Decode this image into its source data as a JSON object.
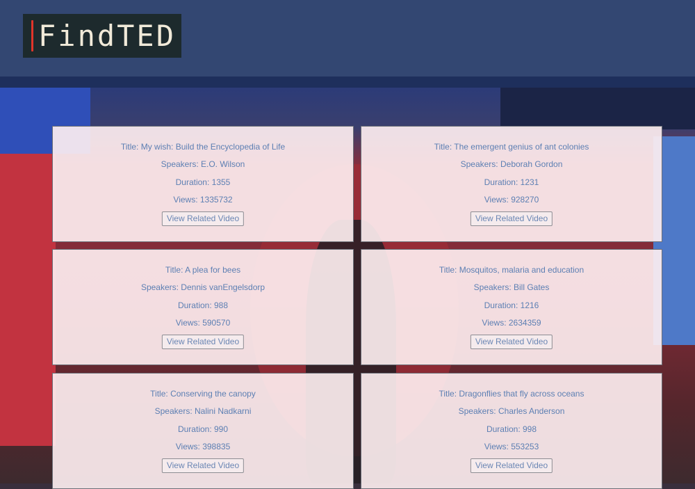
{
  "header": {
    "logo_text": "FindTED"
  },
  "cards": [
    {
      "title": "Title: My wish: Build the Encyclopedia of Life",
      "speakers": "Speakers: E.O. Wilson",
      "duration": "Duration: 1355",
      "views": "Views: 1335732",
      "button": "View Related Video"
    },
    {
      "title": "Title: The emergent genius of ant colonies",
      "speakers": "Speakers: Deborah Gordon",
      "duration": "Duration: 1231",
      "views": "Views: 928270",
      "button": "View Related Video"
    },
    {
      "title": "Title: A plea for bees",
      "speakers": "Speakers: Dennis vanEngelsdorp",
      "duration": "Duration: 988",
      "views": "Views: 590570",
      "button": "View Related Video"
    },
    {
      "title": "Title: Mosquitos, malaria and education",
      "speakers": "Speakers: Bill Gates",
      "duration": "Duration: 1216",
      "views": "Views: 2634359",
      "button": "View Related Video"
    },
    {
      "title": "Title: Conserving the canopy",
      "speakers": "Speakers: Nalini Nadkarni",
      "duration": "Duration: 990",
      "views": "Views: 398835",
      "button": "View Related Video"
    },
    {
      "title": "Title: Dragonflies that fly across oceans",
      "speakers": "Speakers: Charles Anderson",
      "duration": "Duration: 998",
      "views": "Views: 553253",
      "button": "View Related Video"
    }
  ],
  "colors": {
    "header": "#334772",
    "header_strip": "#1e2f5c",
    "card_text": "#5c7fb3",
    "logo_accent": "#e0352a"
  }
}
